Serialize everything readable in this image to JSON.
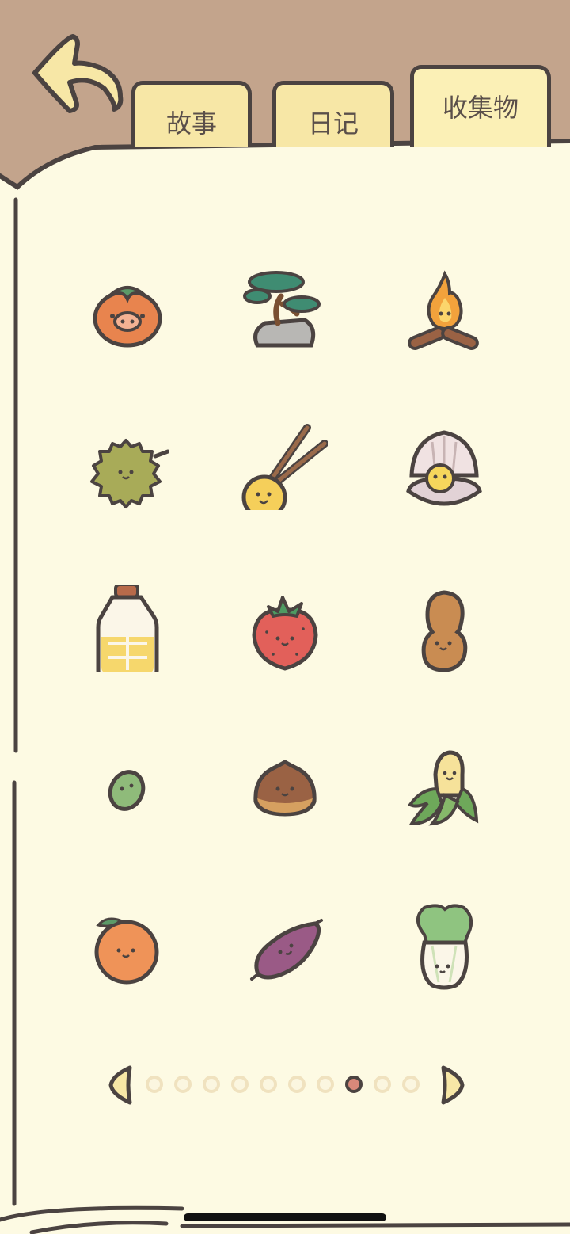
{
  "tabs": {
    "story": "故事",
    "diary": "日记",
    "collection": "收集物"
  },
  "collection_items": [
    [
      "persimmon-icon",
      "bonsai-icon",
      "campfire-icon"
    ],
    [
      "durian-icon",
      "tangyuan-skewer-icon",
      "pearl-shell-icon"
    ],
    [
      "oil-bottle-icon",
      "strawberry-icon",
      "peanut-icon"
    ],
    [
      "bean-icon",
      "chestnut-icon",
      "banana-icon"
    ],
    [
      "orange-icon",
      "sweet-potato-icon",
      "bok-choy-icon"
    ]
  ],
  "pager": {
    "page_count": 10,
    "current_page": 8
  },
  "colors": {
    "background": "#c3a48c",
    "paper": "#fdfae3",
    "outline": "#4b4341",
    "tab": "#f7e7a6",
    "active_dot": "#d8887a"
  }
}
